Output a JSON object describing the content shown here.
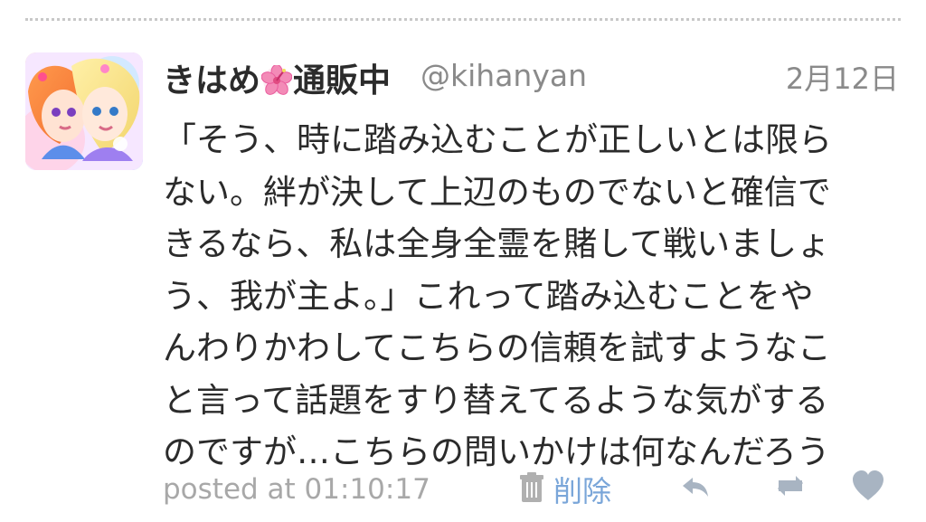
{
  "tweet": {
    "display_name_prefix": "きはめ",
    "display_name_suffix": "通販中",
    "username": "@kihanyan",
    "date": "2月12日",
    "lines": [
      "「そう、時に踏み込むことが正しいとは限ら",
      "ない。絆が決して上辺のものでないと確信で",
      "きるなら、私は全身全霊を賭して戦いましょ",
      "う、我が主よ。」これって踏み込むことをや",
      "んわりかわしてこちらの信頼を試すようなこ",
      "と言って話題をすり替えてるような気がする",
      "のですが…こちらの問いかけは何なんだろう"
    ],
    "posted_at": "posted at 01:10:17",
    "delete_label": "削除"
  },
  "icons": {
    "avatar": "avatar-illustration",
    "name_emoji": "hibiscus-icon",
    "delete": "trash-icon",
    "reply": "reply-icon",
    "retweet": "retweet-icon",
    "like": "heart-icon"
  },
  "colors": {
    "text": "#2b2b2b",
    "meta": "#8a8a8a",
    "posted": "#a8a8a8",
    "delete": "#7aa6d9",
    "action_icon": "#a8b4c2"
  }
}
